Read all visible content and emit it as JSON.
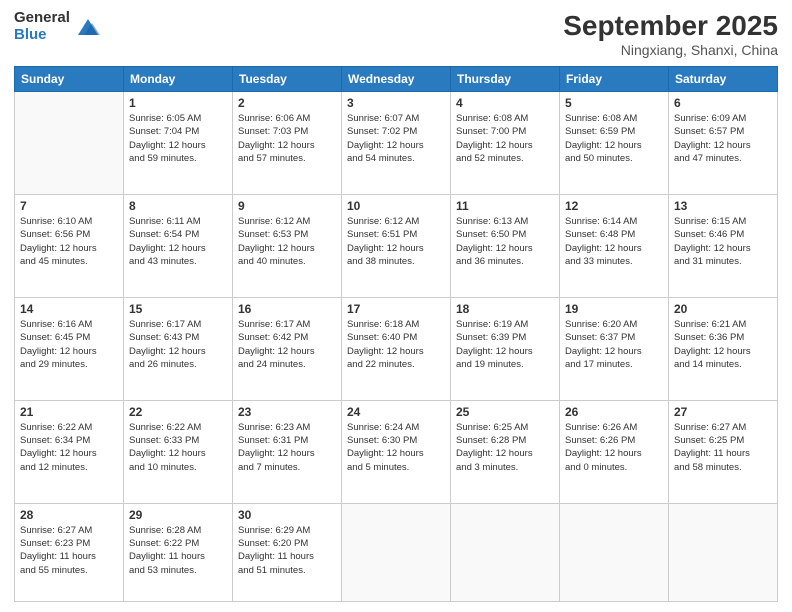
{
  "logo": {
    "general": "General",
    "blue": "Blue"
  },
  "header": {
    "month": "September 2025",
    "location": "Ningxiang, Shanxi, China"
  },
  "days": [
    "Sunday",
    "Monday",
    "Tuesday",
    "Wednesday",
    "Thursday",
    "Friday",
    "Saturday"
  ],
  "weeks": [
    [
      {
        "day": "",
        "info": ""
      },
      {
        "day": "1",
        "info": "Sunrise: 6:05 AM\nSunset: 7:04 PM\nDaylight: 12 hours\nand 59 minutes."
      },
      {
        "day": "2",
        "info": "Sunrise: 6:06 AM\nSunset: 7:03 PM\nDaylight: 12 hours\nand 57 minutes."
      },
      {
        "day": "3",
        "info": "Sunrise: 6:07 AM\nSunset: 7:02 PM\nDaylight: 12 hours\nand 54 minutes."
      },
      {
        "day": "4",
        "info": "Sunrise: 6:08 AM\nSunset: 7:00 PM\nDaylight: 12 hours\nand 52 minutes."
      },
      {
        "day": "5",
        "info": "Sunrise: 6:08 AM\nSunset: 6:59 PM\nDaylight: 12 hours\nand 50 minutes."
      },
      {
        "day": "6",
        "info": "Sunrise: 6:09 AM\nSunset: 6:57 PM\nDaylight: 12 hours\nand 47 minutes."
      }
    ],
    [
      {
        "day": "7",
        "info": "Sunrise: 6:10 AM\nSunset: 6:56 PM\nDaylight: 12 hours\nand 45 minutes."
      },
      {
        "day": "8",
        "info": "Sunrise: 6:11 AM\nSunset: 6:54 PM\nDaylight: 12 hours\nand 43 minutes."
      },
      {
        "day": "9",
        "info": "Sunrise: 6:12 AM\nSunset: 6:53 PM\nDaylight: 12 hours\nand 40 minutes."
      },
      {
        "day": "10",
        "info": "Sunrise: 6:12 AM\nSunset: 6:51 PM\nDaylight: 12 hours\nand 38 minutes."
      },
      {
        "day": "11",
        "info": "Sunrise: 6:13 AM\nSunset: 6:50 PM\nDaylight: 12 hours\nand 36 minutes."
      },
      {
        "day": "12",
        "info": "Sunrise: 6:14 AM\nSunset: 6:48 PM\nDaylight: 12 hours\nand 33 minutes."
      },
      {
        "day": "13",
        "info": "Sunrise: 6:15 AM\nSunset: 6:46 PM\nDaylight: 12 hours\nand 31 minutes."
      }
    ],
    [
      {
        "day": "14",
        "info": "Sunrise: 6:16 AM\nSunset: 6:45 PM\nDaylight: 12 hours\nand 29 minutes."
      },
      {
        "day": "15",
        "info": "Sunrise: 6:17 AM\nSunset: 6:43 PM\nDaylight: 12 hours\nand 26 minutes."
      },
      {
        "day": "16",
        "info": "Sunrise: 6:17 AM\nSunset: 6:42 PM\nDaylight: 12 hours\nand 24 minutes."
      },
      {
        "day": "17",
        "info": "Sunrise: 6:18 AM\nSunset: 6:40 PM\nDaylight: 12 hours\nand 22 minutes."
      },
      {
        "day": "18",
        "info": "Sunrise: 6:19 AM\nSunset: 6:39 PM\nDaylight: 12 hours\nand 19 minutes."
      },
      {
        "day": "19",
        "info": "Sunrise: 6:20 AM\nSunset: 6:37 PM\nDaylight: 12 hours\nand 17 minutes."
      },
      {
        "day": "20",
        "info": "Sunrise: 6:21 AM\nSunset: 6:36 PM\nDaylight: 12 hours\nand 14 minutes."
      }
    ],
    [
      {
        "day": "21",
        "info": "Sunrise: 6:22 AM\nSunset: 6:34 PM\nDaylight: 12 hours\nand 12 minutes."
      },
      {
        "day": "22",
        "info": "Sunrise: 6:22 AM\nSunset: 6:33 PM\nDaylight: 12 hours\nand 10 minutes."
      },
      {
        "day": "23",
        "info": "Sunrise: 6:23 AM\nSunset: 6:31 PM\nDaylight: 12 hours\nand 7 minutes."
      },
      {
        "day": "24",
        "info": "Sunrise: 6:24 AM\nSunset: 6:30 PM\nDaylight: 12 hours\nand 5 minutes."
      },
      {
        "day": "25",
        "info": "Sunrise: 6:25 AM\nSunset: 6:28 PM\nDaylight: 12 hours\nand 3 minutes."
      },
      {
        "day": "26",
        "info": "Sunrise: 6:26 AM\nSunset: 6:26 PM\nDaylight: 12 hours\nand 0 minutes."
      },
      {
        "day": "27",
        "info": "Sunrise: 6:27 AM\nSunset: 6:25 PM\nDaylight: 11 hours\nand 58 minutes."
      }
    ],
    [
      {
        "day": "28",
        "info": "Sunrise: 6:27 AM\nSunset: 6:23 PM\nDaylight: 11 hours\nand 55 minutes."
      },
      {
        "day": "29",
        "info": "Sunrise: 6:28 AM\nSunset: 6:22 PM\nDaylight: 11 hours\nand 53 minutes."
      },
      {
        "day": "30",
        "info": "Sunrise: 6:29 AM\nSunset: 6:20 PM\nDaylight: 11 hours\nand 51 minutes."
      },
      {
        "day": "",
        "info": ""
      },
      {
        "day": "",
        "info": ""
      },
      {
        "day": "",
        "info": ""
      },
      {
        "day": "",
        "info": ""
      }
    ]
  ]
}
